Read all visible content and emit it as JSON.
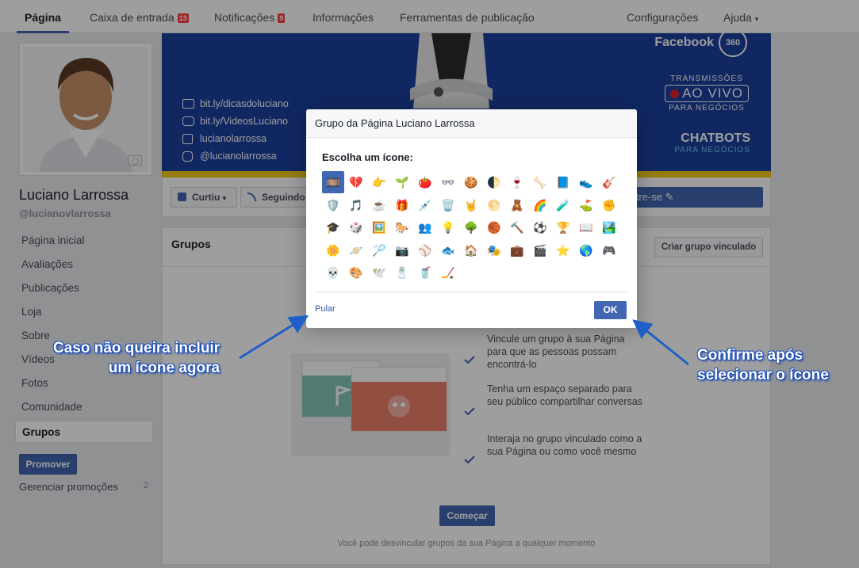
{
  "nav": {
    "tabs": [
      {
        "label": "Página"
      },
      {
        "label": "Caixa de entrada",
        "badge": "13"
      },
      {
        "label": "Notificações",
        "badge": "9"
      },
      {
        "label": "Informações"
      },
      {
        "label": "Ferramentas de publicação"
      }
    ],
    "settings": "Configurações",
    "help": "Ajuda",
    "help_caret": "▾"
  },
  "profile": {
    "name": "Luciano Larrossa",
    "handle": "@lucianovlarrossa"
  },
  "sidebar": {
    "items": [
      {
        "label": "Página inicial"
      },
      {
        "label": "Avaliações"
      },
      {
        "label": "Publicações"
      },
      {
        "label": "Loja"
      },
      {
        "label": "Sobre"
      },
      {
        "label": "Vídeos"
      },
      {
        "label": "Fotos"
      },
      {
        "label": "Comunidade"
      },
      {
        "label": "Grupos"
      }
    ],
    "promote": "Promover",
    "manage_promotions": "Gerenciar promoções",
    "manage_count": "2"
  },
  "cover": {
    "links": [
      "bit.ly/dicasdoluciano",
      "bit.ly/VideosLuciano",
      "lucianolarrossa",
      "@lucianolarrossa"
    ],
    "facebook360": "Facebook",
    "ring_label": "360",
    "transmissoes_top": "TRANSMISSÕES",
    "transmissoes_live": "AO VIVO",
    "transmissoes_sub": "PARA NEGÓCIOS",
    "chatbots": "CHATBOTS",
    "chatbots_sub": "PARA NEGÓCIOS"
  },
  "actions": {
    "liked": "Curtiu",
    "following": "Seguindo",
    "signup": "astre-se",
    "caret": "▾",
    "pencil": "✎"
  },
  "groups": {
    "title": "Grupos",
    "create_linked": "Criar grupo vinculado",
    "features": [
      "Vincule um grupo à sua Página para que as pessoas possam encontrá-lo",
      "Tenha um espaço separado para seu público compartilhar conversas",
      "Interaja no grupo vinculado como a sua Página ou como você mesmo"
    ],
    "start": "Começar",
    "footnote": "Você pode desvincular grupos da sua Página a qualquer momento"
  },
  "modal": {
    "title": "Grupo da Página Luciano Larrossa",
    "subtitle": "Escolha um ícone:",
    "icons": [
      "🎞️",
      "💔",
      "👉",
      "🌱",
      "🍅",
      "👓",
      "🍪",
      "🌓",
      "🍷",
      "🦴",
      "📘",
      "👟",
      "🎸",
      "🛡️",
      "🎵",
      "☕",
      "🎁",
      "💉",
      "🗑️",
      "🤘",
      "🌕",
      "🧸",
      "🌈",
      "🧪",
      "⛳",
      "✊",
      "🎓",
      "🎲",
      "🖼️",
      "🐎",
      "👥",
      "💡",
      "🌳",
      "🏀",
      "🔨",
      "⚽",
      "🏆",
      "📖",
      "🏞️",
      "🌼",
      "🪐",
      "🏸",
      "📷",
      "⚾",
      "🐟",
      "🏠",
      "🎭",
      "💼",
      "🎬",
      "⭐",
      "🌎",
      "🎮",
      "💀",
      "🎨",
      "🕊️",
      "🧂",
      "🥤",
      "🏒"
    ],
    "skip": "Pular",
    "ok": "OK"
  },
  "annotations": {
    "left_line1": "Caso não queira incluir",
    "left_line2": "um ícone agora",
    "right_line1": "Confirme após",
    "right_line2": "selecionar o ícone"
  },
  "colors": {
    "brand": "#4267b2",
    "cover_blue": "#1c3f9e",
    "cover_stripe": "#f4c811",
    "annotation_outline": "#1f4fb4",
    "badge": "#fa3e3e"
  }
}
